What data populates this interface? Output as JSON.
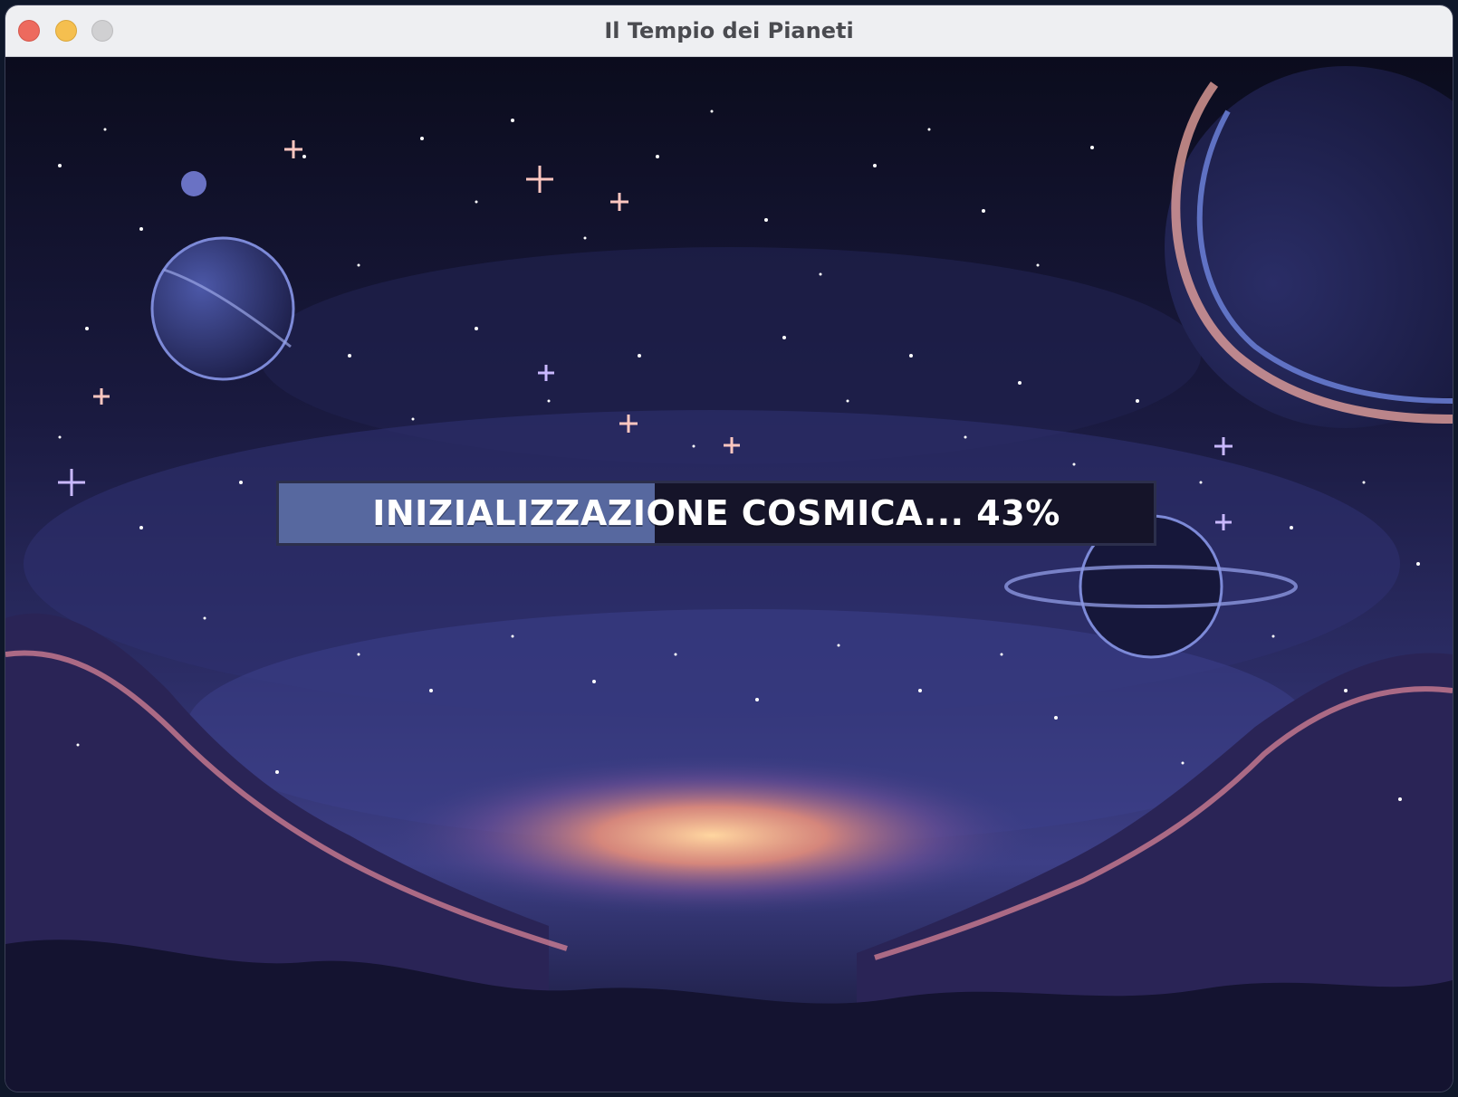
{
  "window": {
    "title": "Il Tempio dei Pianeti"
  },
  "loading": {
    "label": "INIZIALIZZAZIONE COSMICA... 43%",
    "progress_percent": 43
  },
  "colors": {
    "sky_top": "#0c0d1e",
    "sky_mid": "#27285a",
    "cloud_blue": "#4a4f99",
    "horizon_glow": "#f0a070",
    "bar_fill": "#57689f",
    "bar_track": "#151429",
    "text": "#ffffff"
  }
}
